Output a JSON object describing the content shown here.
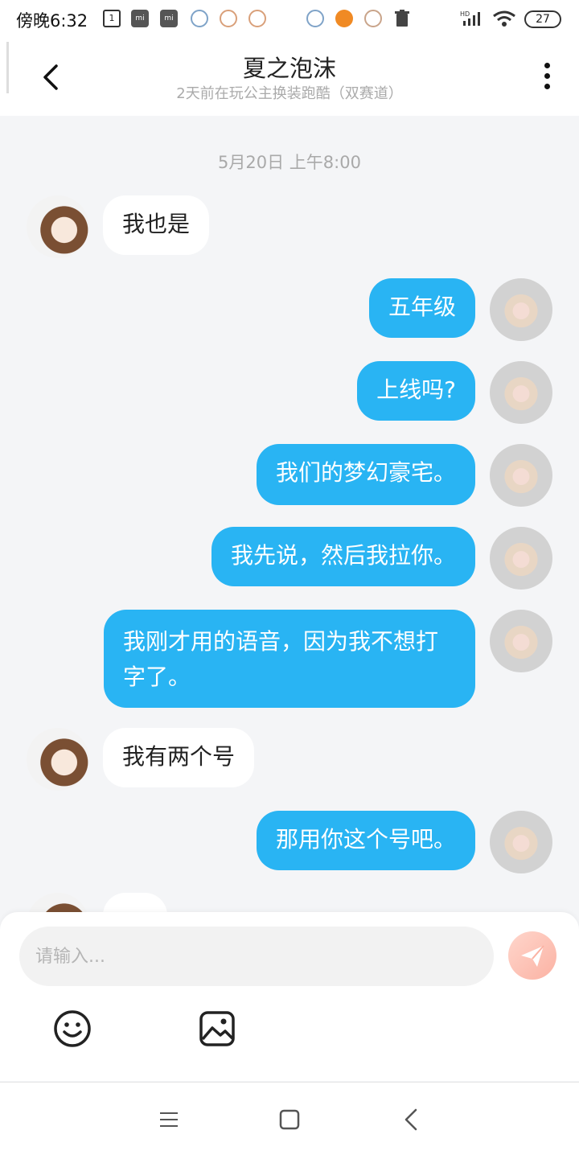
{
  "status_bar": {
    "time": "傍晚6:32",
    "notif_box_label": "1",
    "mi_label": "mi",
    "battery": "27",
    "signal_label": "HD"
  },
  "header": {
    "title": "夏之泡沫",
    "subtitle": "2天前在玩公主换装跑酷（双赛道）"
  },
  "chat": {
    "timestamp": "5月20日 上午8:00",
    "messages": [
      {
        "side": "in",
        "text": "我也是"
      },
      {
        "side": "out",
        "text": "五年级"
      },
      {
        "side": "out",
        "text": "上线吗?"
      },
      {
        "side": "out",
        "text": "我们的梦幻豪宅。"
      },
      {
        "side": "out",
        "text": "我先说，然后我拉你。"
      },
      {
        "side": "out",
        "text": "我刚才用的语音，因为我不想打字了。"
      },
      {
        "side": "in",
        "text": "我有两个号"
      },
      {
        "side": "out",
        "text": "那用你这个号吧。"
      }
    ]
  },
  "composer": {
    "placeholder": "请输入..."
  },
  "colors": {
    "outgoing_bubble": "#29b4f3",
    "incoming_bubble": "#ffffff",
    "send_button": "#fbb2a3"
  }
}
